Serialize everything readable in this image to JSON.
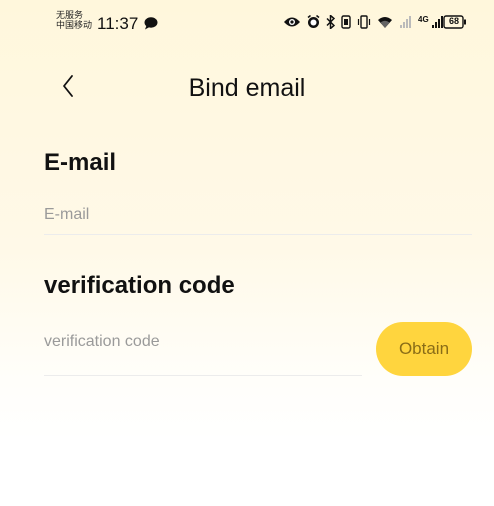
{
  "status_bar": {
    "carrier_line1": "无服务",
    "carrier_line2": "中国移动",
    "time": "11:37",
    "network_label": "4G",
    "battery": "68"
  },
  "header": {
    "title": "Bind email"
  },
  "email_section": {
    "label": "E-mail",
    "placeholder": "E-mail",
    "value": ""
  },
  "code_section": {
    "label": "verification code",
    "placeholder": "verification code",
    "value": "",
    "obtain_label": "Obtain"
  },
  "colors": {
    "accent": "#ffd53e",
    "background_top": "#fff7dc"
  }
}
